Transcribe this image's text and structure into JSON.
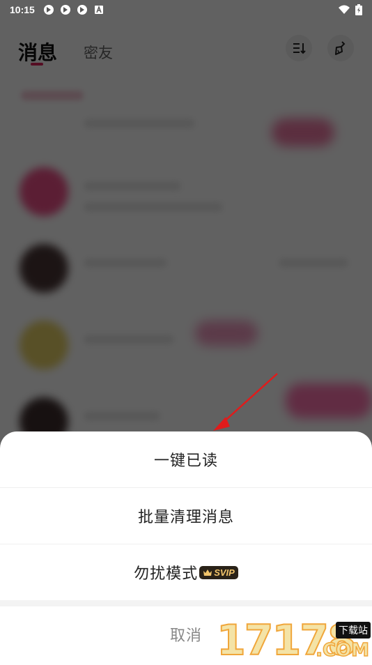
{
  "status_bar": {
    "time": "10:15",
    "icons": [
      "app-notification-icon",
      "app-notification-icon",
      "app-notification-icon",
      "keyboard-a-icon"
    ],
    "right_icons": [
      "wifi-icon",
      "battery-charging-icon"
    ]
  },
  "header": {
    "tabs": [
      {
        "label": "消息",
        "active": true
      },
      {
        "label": "密友",
        "active": false
      }
    ],
    "buttons": [
      "sort-icon",
      "broom-icon"
    ]
  },
  "sheet": {
    "items": [
      {
        "label": "一键已读"
      },
      {
        "label": "批量清理消息"
      },
      {
        "label": "勿扰模式",
        "badge": "SVIP"
      }
    ],
    "cancel_label": "取消"
  },
  "watermark": {
    "number": "17178",
    "badge": "下载站",
    "suffix": ".COM"
  },
  "colors": {
    "accent": "#e0245e",
    "overlay": "#000000",
    "svip_bg": "#2a2218",
    "svip_text": "#f2c46a",
    "arrow": "#e01b1b"
  }
}
